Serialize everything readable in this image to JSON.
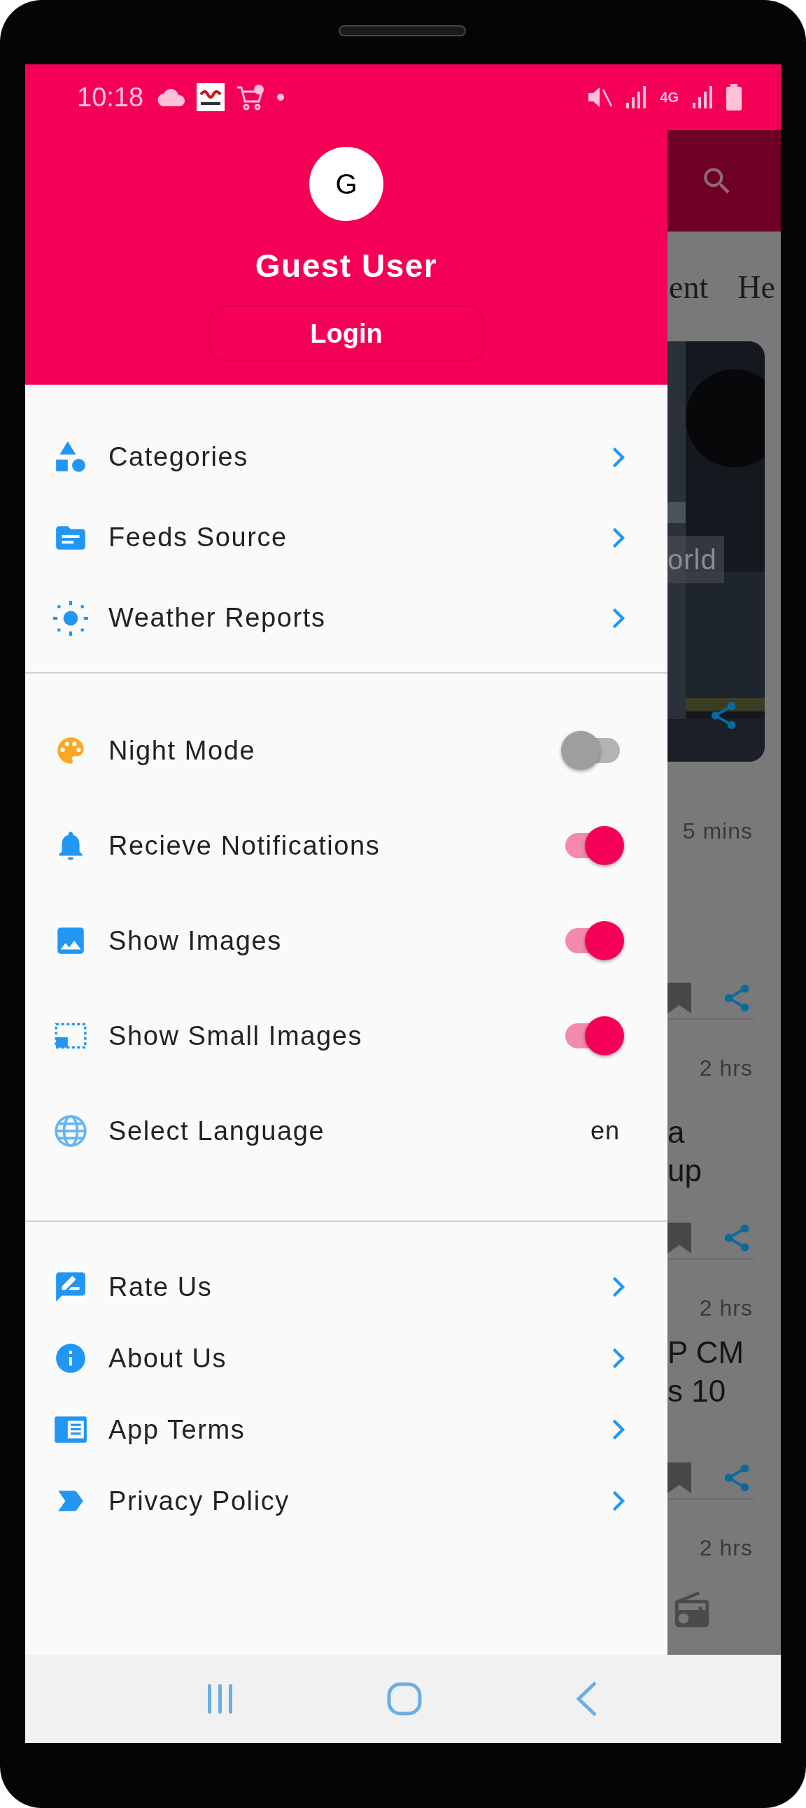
{
  "status_bar": {
    "time": "10:18",
    "network_type": "4G"
  },
  "drawer": {
    "avatar_letter": "G",
    "user_name": "Guest User",
    "login_button": "Login",
    "sections": [
      [
        {
          "kind": "link",
          "label": "Categories"
        },
        {
          "kind": "link",
          "label": "Feeds Source"
        },
        {
          "kind": "link",
          "label": "Weather Reports"
        }
      ],
      [
        {
          "kind": "toggle",
          "label": "Night Mode",
          "on": false
        },
        {
          "kind": "toggle",
          "label": "Recieve Notifications",
          "on": true
        },
        {
          "kind": "toggle",
          "label": "Show Images",
          "on": true
        },
        {
          "kind": "toggle",
          "label": "Show Small Images",
          "on": true
        },
        {
          "kind": "value",
          "label": "Select Language",
          "value": "en"
        }
      ],
      [
        {
          "kind": "link",
          "label": "Rate Us"
        },
        {
          "kind": "link",
          "label": "About Us"
        },
        {
          "kind": "link",
          "label": "App Terms"
        },
        {
          "kind": "link",
          "label": "Privacy Policy"
        }
      ]
    ]
  },
  "background_app": {
    "tabs": [
      "ent",
      "He"
    ],
    "feature_caption": "orld",
    "feature_time": "5 mins",
    "stories": [
      {
        "time": "2 hrs",
        "title_lines": [
          "a",
          "up"
        ]
      },
      {
        "time": "2 hrs",
        "title_lines": [
          "P CM",
          "s 10"
        ]
      },
      {
        "time": "2 hrs"
      }
    ]
  }
}
